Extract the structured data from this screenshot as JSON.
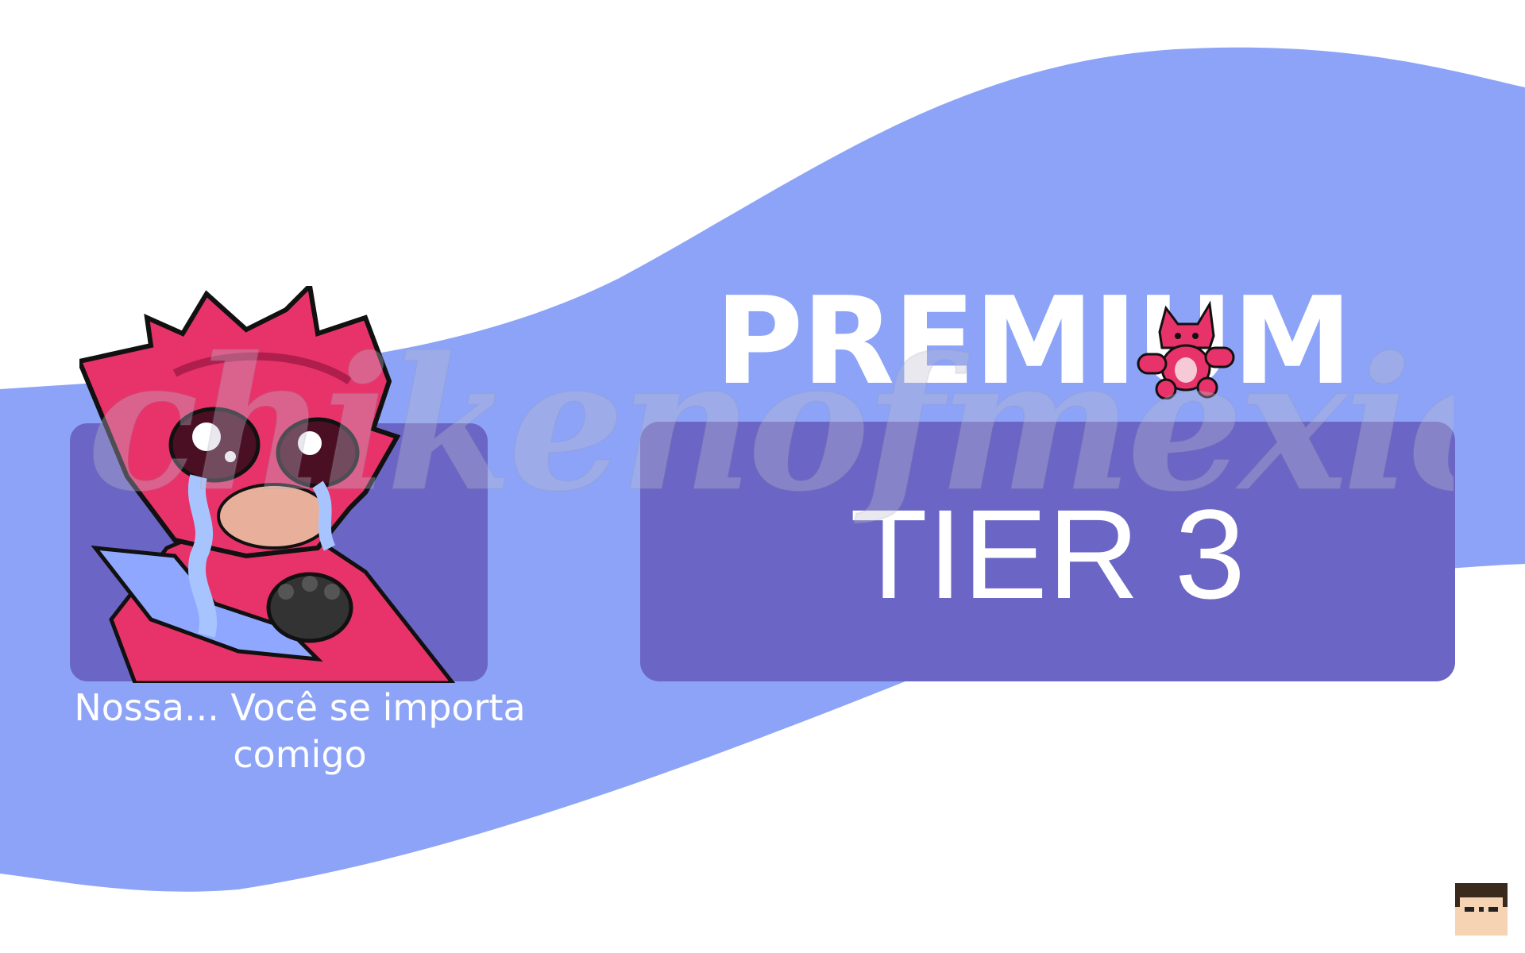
{
  "colors": {
    "wave": "#8ca3f7",
    "panel": "#6b65c5",
    "text": "#ffffff",
    "mascot_fur": "#e8336a"
  },
  "emote": {
    "icon": "crying-fox-emote-icon",
    "caption": "Nossa... Você se importa comigo"
  },
  "premium": {
    "title": "PREMIUM",
    "mascot_icon": "fox-plush-icon"
  },
  "tier": {
    "label": "TIER 3"
  },
  "watermark": {
    "text": "chikenofmexico"
  },
  "avatar": {
    "icon": "pixel-face-avatar-icon"
  }
}
